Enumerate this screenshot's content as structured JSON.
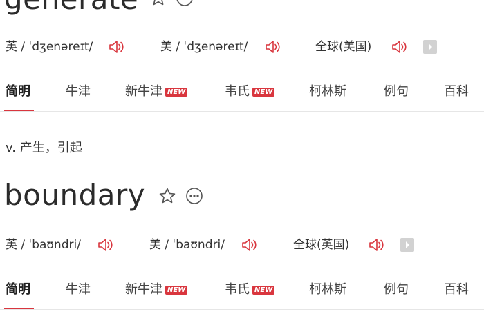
{
  "entry1": {
    "word": "generate",
    "pronunciations": [
      {
        "label": "英",
        "ipa": "/ ˈdʒenəreɪt/"
      },
      {
        "label": "美",
        "ipa": "/ ˈdʒenəreɪt/"
      },
      {
        "label": "全球(美国)",
        "ipa": ""
      }
    ],
    "tabs": [
      {
        "label": "简明",
        "badge": ""
      },
      {
        "label": "牛津",
        "badge": ""
      },
      {
        "label": "新牛津",
        "badge": "NEW"
      },
      {
        "label": "韦氏",
        "badge": "NEW"
      },
      {
        "label": "柯林斯",
        "badge": ""
      },
      {
        "label": "例句",
        "badge": ""
      },
      {
        "label": "百科",
        "badge": ""
      }
    ],
    "definition": "v. 产生，引起"
  },
  "entry2": {
    "word": "boundary",
    "pronunciations": [
      {
        "label": "英",
        "ipa": "/ ˈbaʊndri/"
      },
      {
        "label": "美",
        "ipa": "/ ˈbaʊndri/"
      },
      {
        "label": "全球(英国)",
        "ipa": ""
      }
    ],
    "tabs": [
      {
        "label": "简明",
        "badge": ""
      },
      {
        "label": "牛津",
        "badge": ""
      },
      {
        "label": "新牛津",
        "badge": "NEW"
      },
      {
        "label": "韦氏",
        "badge": "NEW"
      },
      {
        "label": "柯林斯",
        "badge": ""
      },
      {
        "label": "例句",
        "badge": ""
      },
      {
        "label": "百科",
        "badge": ""
      }
    ]
  },
  "colors": {
    "accent": "#d9363e",
    "speaker": "#d9363e",
    "text": "#222222",
    "divider": "#e6e6e6"
  },
  "icons": {
    "star": "star-outline-icon",
    "more": "more-horizontal-icon",
    "speaker": "speaker-icon",
    "expand": "chevron-right-icon"
  }
}
